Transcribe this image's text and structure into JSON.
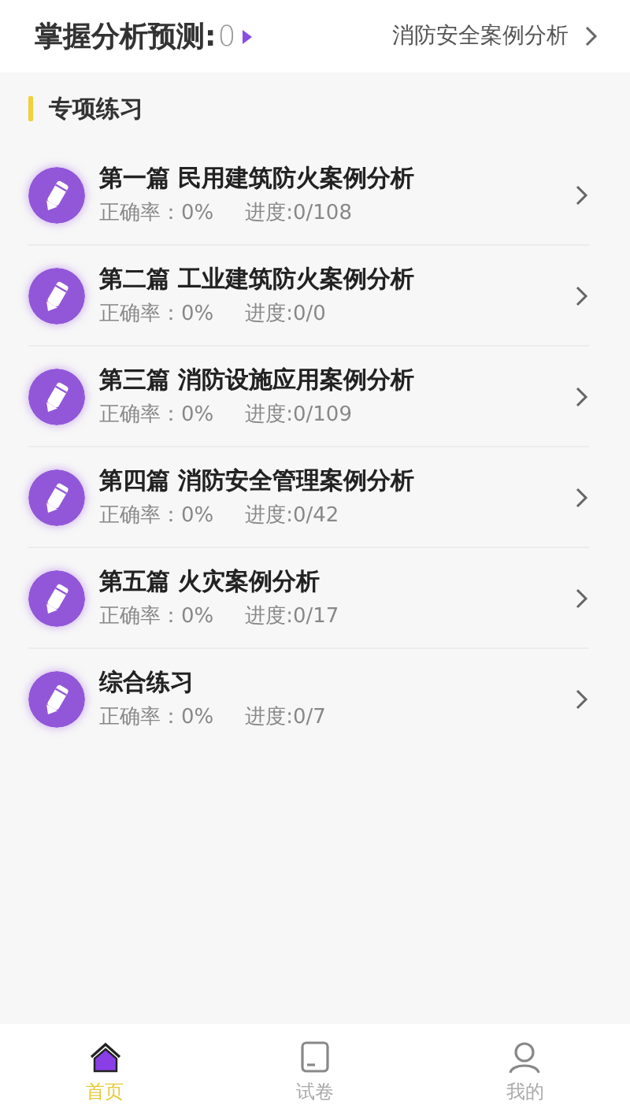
{
  "header": {
    "title": "掌握分析预测:",
    "score": "0",
    "link": "消防安全案例分析"
  },
  "section": {
    "title": "专项练习"
  },
  "items": [
    {
      "title": "第一篇 民用建筑防火案例分析",
      "accuracy": "正确率：0%",
      "progress": "进度:0/108"
    },
    {
      "title": "第二篇 工业建筑防火案例分析",
      "accuracy": "正确率：0%",
      "progress": "进度:0/0"
    },
    {
      "title": "第三篇 消防设施应用案例分析",
      "accuracy": "正确率：0%",
      "progress": "进度:0/109"
    },
    {
      "title": "第四篇 消防安全管理案例分析",
      "accuracy": "正确率：0%",
      "progress": "进度:0/42"
    },
    {
      "title": "第五篇 火灾案例分析",
      "accuracy": "正确率：0%",
      "progress": "进度:0/17"
    },
    {
      "title": "综合练习",
      "accuracy": "正确率：0%",
      "progress": "进度:0/7"
    }
  ],
  "tabs": [
    {
      "kind": "home",
      "label": "首页",
      "selected": true
    },
    {
      "kind": "paper",
      "label": "试卷",
      "selected": false
    },
    {
      "kind": "profile",
      "label": "我的",
      "selected": false
    }
  ]
}
